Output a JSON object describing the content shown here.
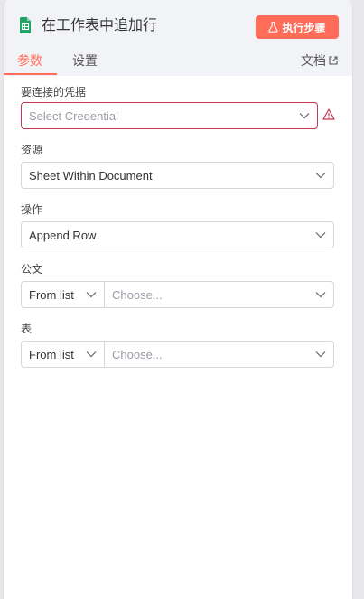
{
  "header": {
    "title": "在工作表中追加行",
    "execute_label": "执行步骤"
  },
  "tabs": {
    "params": "参数",
    "settings": "设置",
    "docs": "文档"
  },
  "fields": {
    "credential": {
      "label": "要连接的凭据",
      "placeholder": "Select Credential"
    },
    "resource": {
      "label": "资源",
      "value": "Sheet Within Document"
    },
    "operation": {
      "label": "操作",
      "value": "Append Row"
    },
    "document": {
      "label": "公文",
      "mode": "From list",
      "placeholder": "Choose..."
    },
    "sheet": {
      "label": "表",
      "mode": "From list",
      "placeholder": "Choose..."
    }
  },
  "colors": {
    "accent": "#ff6d5a",
    "error": "#c4384d",
    "sheet_icon": "#21a366"
  }
}
